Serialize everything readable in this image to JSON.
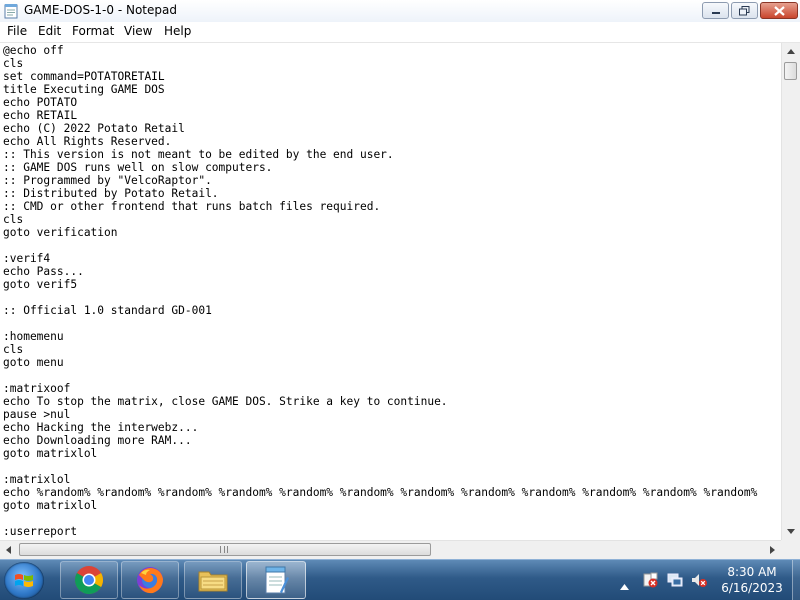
{
  "window": {
    "title": "GAME-DOS-1-0 - Notepad"
  },
  "menu": [
    "File",
    "Edit",
    "Format",
    "View",
    "Help"
  ],
  "editor": {
    "lines": [
      "@echo off",
      "cls",
      "set command=POTATORETAIL",
      "title Executing GAME DOS",
      "echo POTATO",
      "echo RETAIL",
      "echo (C) 2022 Potato Retail",
      "echo All Rights Reserved.",
      ":: This version is not meant to be edited by the end user.",
      ":: GAME DOS runs well on slow computers.",
      ":: Programmed by \"VelcoRaptor\".",
      ":: Distributed by Potato Retail.",
      ":: CMD or other frontend that runs batch files required.",
      "cls",
      "goto verification",
      "",
      ":verif4",
      "echo Pass...",
      "goto verif5",
      "",
      ":: Official 1.0 standard GD-001",
      "",
      ":homemenu",
      "cls",
      "goto menu",
      "",
      ":matrixoof",
      "echo To stop the matrix, close GAME DOS. Strike a key to continue.",
      "pause >nul",
      "echo Hacking the interwebz...",
      "echo Downloading more RAM...",
      "goto matrixlol",
      "",
      ":matrixlol",
      "echo %random% %random% %random% %random% %random% %random% %random% %random% %random% %random% %random% %random%",
      "goto matrixlol",
      "",
      ":userreport"
    ]
  },
  "taskbar": {
    "pinned": [
      {
        "name": "chrome-icon"
      },
      {
        "name": "firefox-icon"
      },
      {
        "name": "file-explorer-icon"
      },
      {
        "name": "notepad-icon"
      }
    ],
    "clock": {
      "time": "8:30 AM",
      "date": "6/16/2023"
    }
  },
  "colors": {
    "taskbar": "#2f5a88",
    "close_button": "#c9452c",
    "text": "#000000"
  }
}
